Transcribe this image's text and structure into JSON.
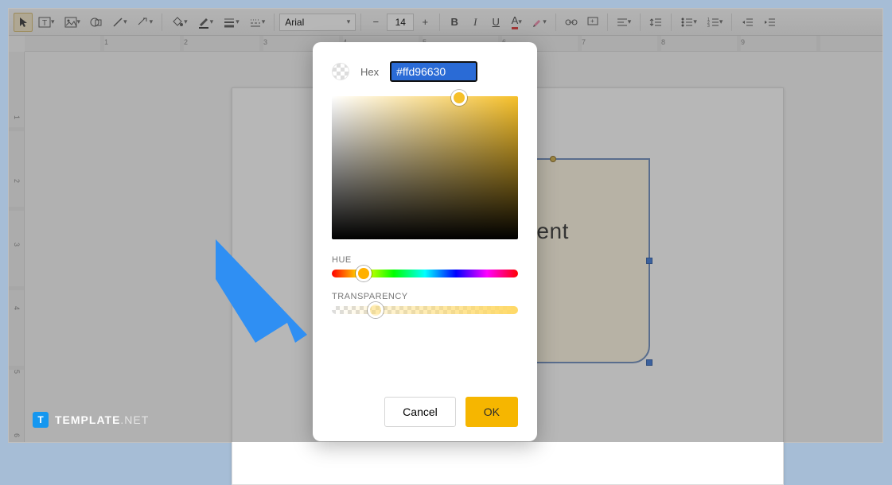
{
  "toolbar": {
    "font_name": "Arial",
    "font_size": "14",
    "minus": "−",
    "plus": "+",
    "bold": "B",
    "italic": "I",
    "underline": "U",
    "text_color_letter": "A"
  },
  "ruler": {
    "h": [
      "1",
      "2",
      "3",
      "4",
      "5",
      "6",
      "7",
      "8",
      "9"
    ],
    "v": [
      "1",
      "2",
      "3",
      "4",
      "5",
      "6"
    ]
  },
  "shape": {
    "visible_text": "ontent"
  },
  "color_picker": {
    "hex_label": "Hex",
    "hex_value": "#ffd96630",
    "hue_label": "HUE",
    "transparency_label": "TRANSPARENCY",
    "cancel": "Cancel",
    "ok": "OK"
  },
  "watermark": {
    "badge": "T",
    "brand": "TEMPLATE",
    "tld": ".NET"
  }
}
